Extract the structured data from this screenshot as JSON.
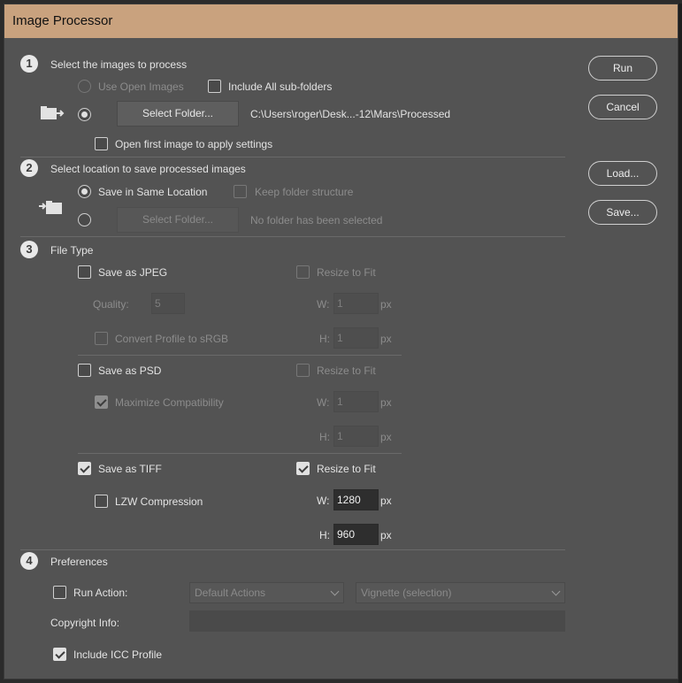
{
  "window": {
    "title": "Image Processor"
  },
  "buttons": {
    "run": "Run",
    "cancel": "Cancel",
    "load": "Load...",
    "save": "Save..."
  },
  "section1": {
    "number": "1",
    "title": "Select the images to process",
    "use_open_images": "Use Open Images",
    "include_subfolders": "Include All sub-folders",
    "select_folder": "Select Folder...",
    "folder_path": "C:\\Users\\roger\\Desk...-12\\Mars\\Processed",
    "open_first_image": "Open first image to apply settings"
  },
  "section2": {
    "number": "2",
    "title": "Select location to save processed images",
    "save_same_location": "Save in Same Location",
    "keep_structure": "Keep folder structure",
    "select_folder": "Select Folder...",
    "no_folder": "No folder has been selected"
  },
  "section3": {
    "number": "3",
    "title": "File Type",
    "jpeg": {
      "label": "Save as JPEG",
      "checked": false,
      "resize_label": "Resize to Fit",
      "resize_checked": false,
      "quality_label": "Quality:",
      "quality": "5",
      "convert_profile": "Convert Profile to sRGB",
      "w_label": "W:",
      "w": "1",
      "h_label": "H:",
      "h": "1",
      "unit": "px"
    },
    "psd": {
      "label": "Save as PSD",
      "checked": false,
      "resize_label": "Resize to Fit",
      "resize_checked": false,
      "maximize": "Maximize Compatibility",
      "maximize_checked": true,
      "w_label": "W:",
      "w": "1",
      "h_label": "H:",
      "h": "1",
      "unit": "px"
    },
    "tiff": {
      "label": "Save as TIFF",
      "checked": true,
      "resize_label": "Resize to Fit",
      "resize_checked": true,
      "lzw": "LZW Compression",
      "lzw_checked": false,
      "w_label": "W:",
      "w": "1280",
      "h_label": "H:",
      "h": "960",
      "unit": "px"
    }
  },
  "section4": {
    "number": "4",
    "title": "Preferences",
    "run_action": "Run Action:",
    "action_set": "Default Actions",
    "action": "Vignette (selection)",
    "copyright_label": "Copyright Info:",
    "copyright_value": "",
    "include_icc": "Include ICC Profile",
    "include_icc_checked": true
  }
}
